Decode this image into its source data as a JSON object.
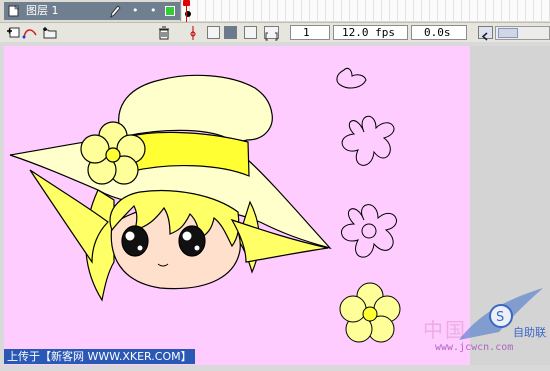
{
  "timeline": {
    "layer_name": "图层 1",
    "frame_number": "1",
    "frame_rate": "12.0 fps",
    "elapsed_time": "0.0s",
    "layer_swatch_color": "#33cc33"
  },
  "stage": {
    "background_color": "#ffccff",
    "hat_color": "#ffffcc",
    "ribbon_color": "#ffff33",
    "hair_color": "#ffff66",
    "flower_color": "#ffff99"
  },
  "caption": {
    "text": "上传于【新客网 WWW.XKER.COM】"
  },
  "watermark": {
    "chinese_text": "中国",
    "site_text": "www.jcwcn.com",
    "logo_text": "自助联盟"
  }
}
